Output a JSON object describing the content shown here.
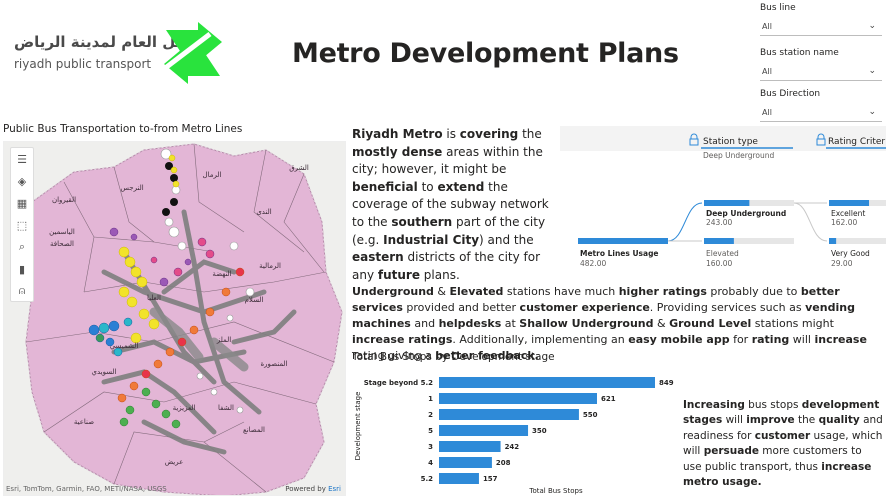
{
  "logo": {
    "arabic_text": "النقل العام لمدينة الرياض",
    "english_text": "riyadh public transport"
  },
  "page_title": "Metro Development Plans",
  "slicers": [
    {
      "label": "Bus line",
      "value": "All"
    },
    {
      "label": "Bus station name",
      "value": "All"
    },
    {
      "label": "Bus Direction",
      "value": "All"
    }
  ],
  "map": {
    "title": "Public Bus Transportation to-from Metro Lines",
    "attribution": "Esri, TomTom, Garmin, FAO, METI/NASA, USGS",
    "powered_by_prefix": "Powered by ",
    "powered_by_brand": "Esri",
    "toolbar_icons": [
      "menu-icon",
      "layers-icon",
      "qr-icon",
      "select-icon",
      "search-icon",
      "bar-chart-icon",
      "person-icon"
    ],
    "district_labels": [
      "الشرق",
      "الرمال",
      "النرجس",
      "القيروان",
      "الندى",
      "الياسمين",
      "الصحافة",
      "الرمالية",
      "النهضة",
      "السلام",
      "العليا",
      "الملز",
      "الشفا",
      "المنصورة",
      "العزيزية",
      "السويدي",
      "الشميسي",
      "المصانع",
      "عريض",
      "صناعية"
    ],
    "colors": {
      "land": "#e3b6d6",
      "background": "#f0f0ee",
      "roads": "#7f7f7f"
    }
  },
  "para1": {
    "t1": "Riyadh Metro",
    "t2": " is ",
    "t3": "covering",
    "t4": " the ",
    "t5": "mostly dense",
    "t6": " areas within the city; however, it might be ",
    "t7": "beneficial",
    "t8": " to ",
    "t9": "extend",
    "t10": " the coverage of the subway network to the ",
    "t11": "southern",
    "t12": " part of the city (e.g. ",
    "t13": "Industrial City",
    "t14": ") and the ",
    "t15": "eastern",
    "t16": " districts of the city for any ",
    "t17": "future",
    "t18": " plans."
  },
  "para2": {
    "t1": "Underground",
    "t2": " & ",
    "t3": "Elevated",
    "t4": " stations have much ",
    "t5": "higher ratings",
    "t6": " probably due to ",
    "t7": "better services",
    "t8": " provided and better ",
    "t9": "customer experience",
    "t10": ". Providing services such as ",
    "t11": "vending machines",
    "t12": " and ",
    "t13": "helpdesks",
    "t14": " at ",
    "t15": "Shallow Underground",
    "t16": " & ",
    "t17": "Ground Level",
    "t18": " stations might ",
    "t19": "increase ratings",
    "t20": ". Additionally, implementing an ",
    "t21": "easy mobile app",
    "t22": " for ",
    "t23": "rating",
    "t24": " will ",
    "t25": "increase",
    "t26": " rating giving a ",
    "t27": "better feedback."
  },
  "para3": {
    "t1": "Increasing",
    "t2": " bus stops ",
    "t3": "development stages",
    "t4": " will ",
    "t5": "improve",
    "t6": " the ",
    "t7": "quality",
    "t8": " and readiness for ",
    "t9": "customer",
    "t10": " usage, which will ",
    "t11": "persuade",
    "t12": " more customers to use public transport, thus ",
    "t13": "increase metro usage."
  },
  "decomposition_tree": {
    "columns": [
      {
        "title": "Station type",
        "subtitle": "Deep Underground"
      },
      {
        "title": "Rating Criter",
        "subtitle": ""
      }
    ],
    "root": {
      "label": "Metro Lines Usage",
      "value": "482.00",
      "fraction": 1.0
    },
    "level1": [
      {
        "label": "Deep Underground",
        "value": "243.00",
        "fraction": 0.504,
        "selected": true
      },
      {
        "label": "Elevated",
        "value": "160.00",
        "fraction": 0.332,
        "selected": false
      }
    ],
    "level2": [
      {
        "label": "Excellent",
        "value": "162.00",
        "fraction": 0.667
      },
      {
        "label": "Very Good",
        "value": "29.00",
        "fraction": 0.119
      }
    ],
    "colors": {
      "bar": "#2e8ad8",
      "track": "#e6e6e6",
      "link": "#2e8ad8"
    }
  },
  "chart_title": "Total Bus Stops by Development stage",
  "chart_data": {
    "type": "bar",
    "orientation": "horizontal",
    "categories": [
      "Stage beyond 5.2",
      "1",
      "2",
      "5",
      "3",
      "4",
      "5.2"
    ],
    "values": [
      849,
      621,
      550,
      350,
      242,
      208,
      157
    ],
    "xlabel": "Total Bus Stops",
    "ylabel": "Development stage",
    "xlim": [
      0,
      849
    ],
    "color": "#2e8ad8"
  }
}
